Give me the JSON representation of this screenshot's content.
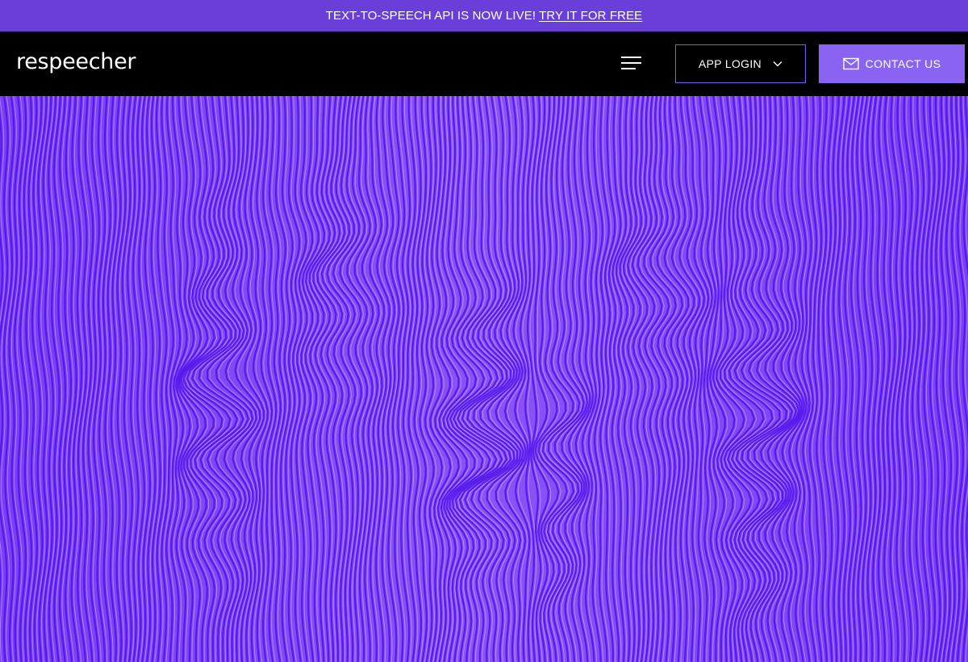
{
  "announcement": {
    "message": "TEXT-TO-SPEECH API IS NOW LIVE!",
    "link_label": "TRY IT FOR FREE"
  },
  "nav": {
    "logo_text": "respeecher",
    "menu_icon": "hamburger-menu-icon",
    "app_login_label": "APP LOGIN",
    "app_login_icon": "chevron-down-icon",
    "contact_label": "CONTACT US",
    "contact_icon": "envelope-icon"
  },
  "colors": {
    "announcement_bg": "#6a3fd9",
    "nav_bg": "#000000",
    "accent": "#8a63f2",
    "hero_base": "#7a3cf6",
    "hero_line_dark": "#4e12ea",
    "hero_highlight": "#ffffff"
  }
}
